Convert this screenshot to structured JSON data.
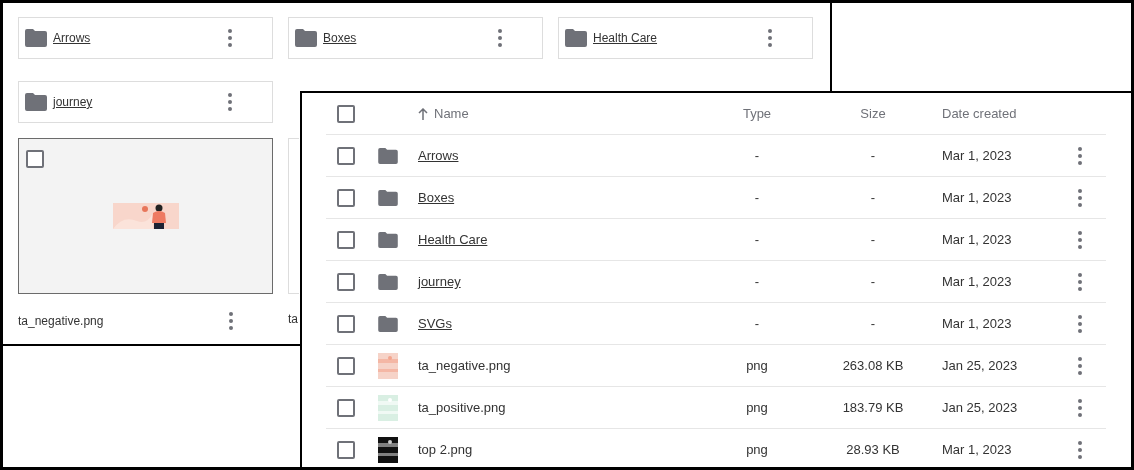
{
  "grid_view": {
    "folders": [
      {
        "name": "Arrows"
      },
      {
        "name": "Boxes"
      },
      {
        "name": "Health Care"
      },
      {
        "name": "journey"
      }
    ],
    "files": [
      {
        "name": "ta_negative.png",
        "checked": false
      }
    ],
    "partial_file_name": "ta"
  },
  "list_view": {
    "header": {
      "checked": false,
      "name": "Name",
      "type": "Type",
      "size": "Size",
      "date": "Date created"
    },
    "rows": [
      {
        "kind": "folder",
        "name": "Arrows",
        "type": "-",
        "size": "-",
        "date": "Mar 1, 2023",
        "checked": false
      },
      {
        "kind": "folder",
        "name": "Boxes",
        "type": "-",
        "size": "-",
        "date": "Mar 1, 2023",
        "checked": false
      },
      {
        "kind": "folder",
        "name": "Health Care",
        "type": "-",
        "size": "-",
        "date": "Mar 1, 2023",
        "checked": false
      },
      {
        "kind": "folder",
        "name": "journey",
        "type": "-",
        "size": "-",
        "date": "Mar 1, 2023",
        "checked": false
      },
      {
        "kind": "folder",
        "name": "SVGs",
        "type": "-",
        "size": "-",
        "date": "Mar 1, 2023",
        "checked": false
      },
      {
        "name": "ta_negative.png",
        "type": "png",
        "size": "263.08 KB",
        "date": "Jan 25, 2023",
        "checked": false
      },
      {
        "name": "ta_positive.png",
        "type": "png",
        "size": "183.79 KB",
        "date": "Jan 25, 2023",
        "checked": false
      },
      {
        "name": "top 2.png",
        "type": "png",
        "size": "28.93 KB",
        "date": "Mar 1, 2023",
        "checked": false
      }
    ]
  }
}
